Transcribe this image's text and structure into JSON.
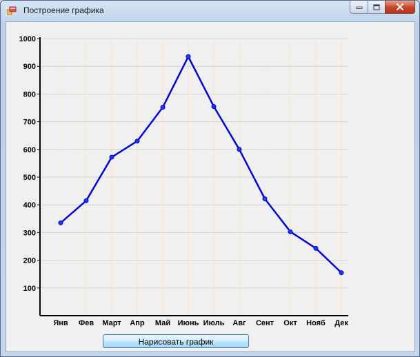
{
  "window": {
    "title": "Построение графика"
  },
  "button": {
    "draw_label": "Нарисовать график"
  },
  "chart_data": {
    "type": "line",
    "categories": [
      "Янв",
      "Фев",
      "Март",
      "Апр",
      "Май",
      "Июнь",
      "Июль",
      "Авг",
      "Сент",
      "Окт",
      "Нояб",
      "Дек"
    ],
    "series": [
      {
        "values": [
          335,
          415,
          572,
          630,
          752,
          935,
          755,
          600,
          422,
          303,
          243,
          155
        ],
        "color": "#0000cc"
      }
    ],
    "y_ticks": [
      100,
      200,
      300,
      400,
      500,
      600,
      700,
      800,
      900,
      1000
    ],
    "ylim": [
      0,
      1000
    ],
    "grid": true,
    "horizontal_grid_color": "#d3d3d3",
    "vertical_grid_color": "#f7e6cc",
    "title": "",
    "xlabel": "",
    "ylabel": ""
  }
}
